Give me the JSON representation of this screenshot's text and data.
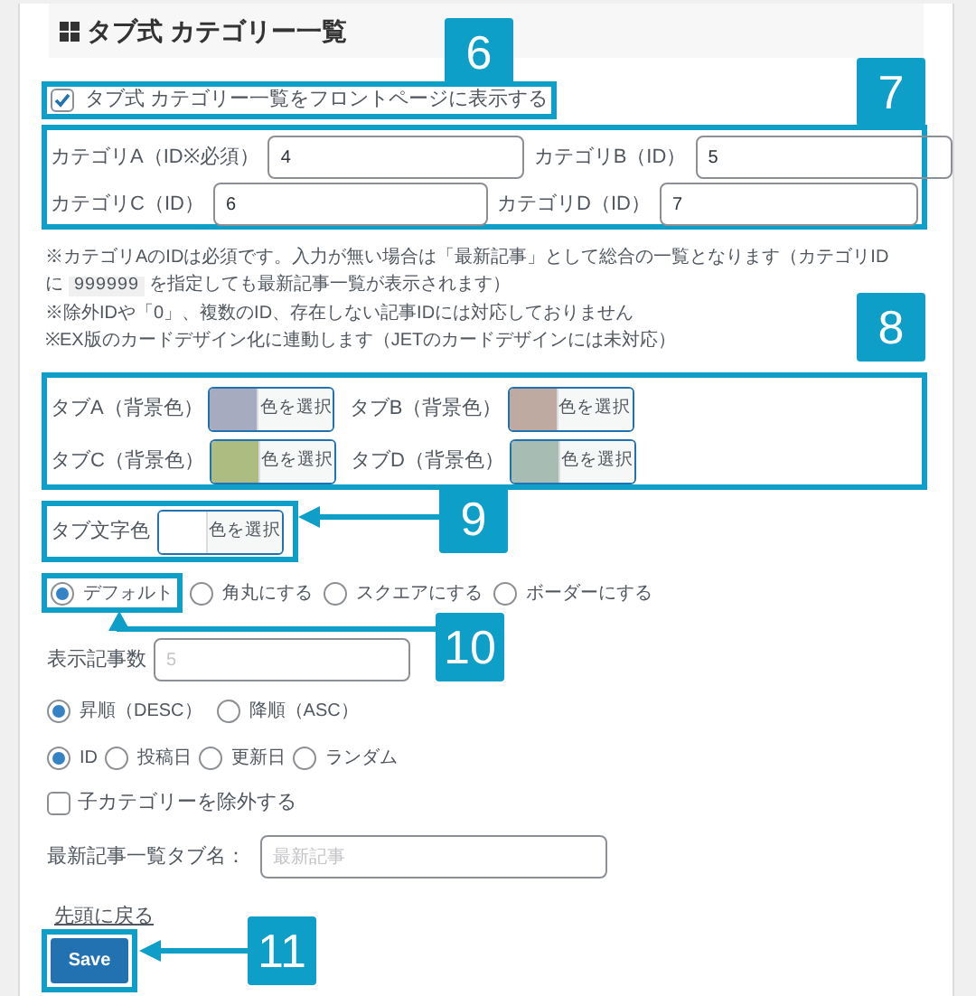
{
  "heading": {
    "title": "タブ式 カテゴリー一覧"
  },
  "show_on_front": {
    "label": "タブ式 カテゴリー一覧をフロントページに表示する",
    "checked": true
  },
  "category_fields": [
    {
      "label": "カテゴリA（ID※必須）",
      "value": "4"
    },
    {
      "label": "カテゴリB（ID）",
      "value": "5"
    },
    {
      "label": "カテゴリC（ID）",
      "value": "6"
    },
    {
      "label": "カテゴリD（ID）",
      "value": "7"
    }
  ],
  "notes": [
    {
      "line": "※カテゴリAのIDは必須です。入力が無い場合は「最新記事」として総合の一覧となります（カテゴリID",
      "prefix": "に",
      "code": "999999",
      "suffix": "を指定しても最新記事一覧が表示されます）"
    },
    {
      "line": "※除外IDや「0」、複数のID、存在しない記事IDには対応しておりません"
    },
    {
      "line": "※EX版のカードデザイン化に連動します（JETのカードデザインには未対応）"
    }
  ],
  "tab_colors": [
    {
      "label": "タブA（背景色）",
      "color": "#a7abbf",
      "button": "色を選択"
    },
    {
      "label": "タブB（背景色）",
      "color": "#bfaaa2",
      "button": "色を選択"
    },
    {
      "label": "タブC（背景色）",
      "color": "#adbd82",
      "button": "色を選択"
    },
    {
      "label": "タブD（背景色）",
      "color": "#a7bcb2",
      "button": "色を選択"
    }
  ],
  "text_color": {
    "label": "タブ文字色",
    "color": "#ffffff",
    "button": "色を選択"
  },
  "tab_styles": [
    {
      "label": "デフォルト",
      "selected": true
    },
    {
      "label": "角丸にする",
      "selected": false
    },
    {
      "label": "スクエアにする",
      "selected": false
    },
    {
      "label": "ボーダーにする",
      "selected": false
    }
  ],
  "post_count": {
    "label": "表示記事数",
    "placeholder": "5"
  },
  "order": [
    {
      "label": "昇順（DESC）",
      "selected": true
    },
    {
      "label": "降順（ASC）",
      "selected": false
    }
  ],
  "sort_by": [
    {
      "label": "ID",
      "selected": true
    },
    {
      "label": "投稿日",
      "selected": false
    },
    {
      "label": "更新日",
      "selected": false
    },
    {
      "label": "ランダム",
      "selected": false
    }
  ],
  "exclude_children": {
    "label": "子カテゴリーを除外する",
    "checked": false
  },
  "latest_tab_name": {
    "label": "最新記事一覧タブ名：",
    "placeholder": "最新記事"
  },
  "back_link": "先頭に戻る",
  "save_button": "Save",
  "callouts": [
    "6",
    "7",
    "8",
    "9",
    "10",
    "11"
  ]
}
